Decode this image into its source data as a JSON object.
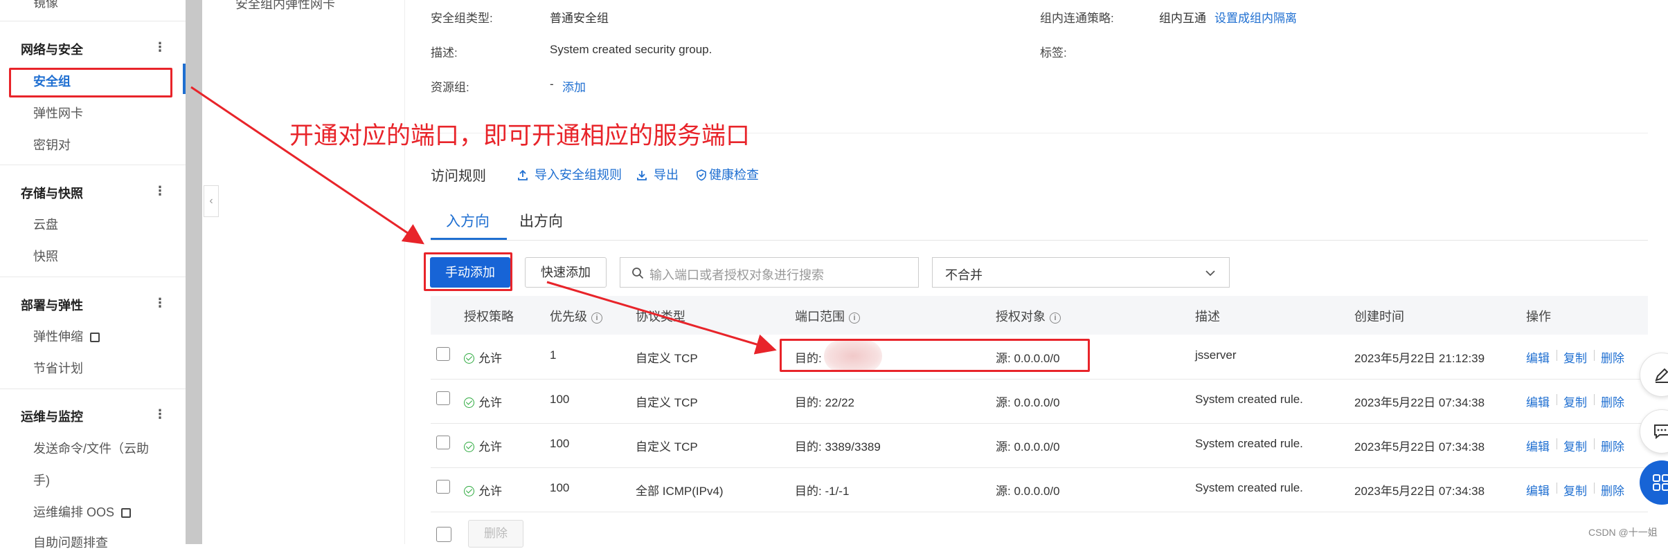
{
  "sidebar": {
    "cut_item": "镜像",
    "groups": [
      {
        "title": "网络与安全",
        "items": [
          "安全组",
          "弹性网卡",
          "密钥对"
        ]
      },
      {
        "title": "存储与快照",
        "items": [
          "云盘",
          "快照"
        ]
      },
      {
        "title": "部署与弹性",
        "items": [
          "弹性伸缩",
          "节省计划"
        ]
      },
      {
        "title": "运维与监控",
        "items": [
          "发送命令/文件（云助",
          "手)",
          "运维编排 OOS",
          "自助问题排查"
        ]
      }
    ],
    "more_glyph": "⋮",
    "collapse_glyph": "‹"
  },
  "left_panel": {
    "cut_item": "安全组内弹性网卡"
  },
  "info": {
    "type_label": "安全组类型:",
    "type_value": "普通安全组",
    "desc_label": "描述:",
    "desc_value": "System created security group.",
    "rg_label": "资源组:",
    "rg_dash": "-",
    "rg_add": "添加",
    "policy_label": "组内连通策略:",
    "policy_value": "组内互通",
    "policy_link": "设置成组内隔离",
    "tags_label": "标签:"
  },
  "annotation": {
    "text": "开通对应的端口，即可开通相应的服务端口",
    "color": "#e8242a"
  },
  "toolbar": {
    "title": "访问规则",
    "import": "导入安全组规则",
    "export": "导出",
    "health": "健康检查"
  },
  "tabs": [
    "入方向",
    "出方向"
  ],
  "actions": {
    "manual_add": "手动添加",
    "quick_add": "快速添加",
    "search_placeholder": "输入端口或者授权对象进行搜索",
    "merge_select": "不合并"
  },
  "table": {
    "headers": [
      "授权策略",
      "优先级",
      "协议类型",
      "端口范围",
      "授权对象",
      "描述",
      "创建时间",
      "操作"
    ],
    "rows": [
      {
        "policy": "允许",
        "priority": "1",
        "protocol": "自定义 TCP",
        "port": "目的:",
        "target": "源: 0.0.0.0/0",
        "desc": "jsserver",
        "time": "2023年5月22日 21:12:39"
      },
      {
        "policy": "允许",
        "priority": "100",
        "protocol": "自定义 TCP",
        "port": "目的: 22/22",
        "target": "源: 0.0.0.0/0",
        "desc": "System created rule.",
        "time": "2023年5月22日 07:34:38"
      },
      {
        "policy": "允许",
        "priority": "100",
        "protocol": "自定义 TCP",
        "port": "目的: 3389/3389",
        "target": "源: 0.0.0.0/0",
        "desc": "System created rule.",
        "time": "2023年5月22日 07:34:38"
      },
      {
        "policy": "允许",
        "priority": "100",
        "protocol": "全部 ICMP(IPv4)",
        "port": "目的: -1/-1",
        "target": "源: 0.0.0.0/0",
        "desc": "System created rule.",
        "time": "2023年5月22日 07:34:38"
      }
    ],
    "op_edit": "编辑",
    "op_copy": "复制",
    "op_delete": "删除",
    "bulk_delete": "删除"
  },
  "watermark": "CSDN @十一姐",
  "colors": {
    "accent": "#1f6fd1",
    "primary_button": "#1764d6",
    "annotation_red": "#e8242a",
    "allow_green": "#2eaa3f"
  },
  "icons": [
    "more-icon",
    "external-link-icon",
    "collapse-icon",
    "upload-icon",
    "download-icon",
    "shield-check-icon",
    "search-icon",
    "chevron-down-icon",
    "check-circle-icon",
    "info-icon",
    "edit-icon",
    "chat-icon",
    "apps-icon"
  ]
}
